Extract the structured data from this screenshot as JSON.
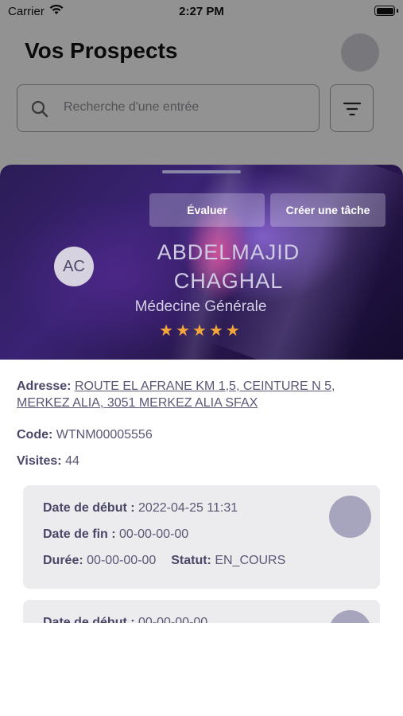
{
  "status_bar": {
    "carrier": "Carrier",
    "time": "2:27 PM"
  },
  "page": {
    "title": "Vos Prospects",
    "search_placeholder": "Recherche d'une entrée"
  },
  "sheet": {
    "buttons": {
      "evaluate": "Évaluer",
      "create_task": "Créer une tâche"
    },
    "avatar_initials": "AC",
    "name_line1": "ABDELMAJID",
    "name_line2": "CHAGHAL",
    "specialty": "Médecine Générale",
    "rating": 5,
    "stars": "★★★★★",
    "address_label": "Adresse:",
    "address_value": "ROUTE EL AFRANE KM 1,5, CEINTURE N 5, MERKEZ ALIA, 3051 MERKEZ ALIA SFAX",
    "code_label": "Code:",
    "code_value": "WTNM00005556",
    "visits_label": "Visites:",
    "visits_value": "44"
  },
  "visits": [
    {
      "start_label": "Date de début :",
      "start_value": "2022-04-25 11:31",
      "end_label": "Date de fin :",
      "end_value": "00-00-00-00",
      "duration_label": "Durée:",
      "duration_value": "00-00-00-00",
      "status_label": "Statut:",
      "status_value": "EN_COURS"
    },
    {
      "start_label": "Date de début :",
      "start_value": "00-00-00-00"
    }
  ],
  "colors": {
    "accent_text": "#5b5775",
    "star": "#f5a63a",
    "hero_dark": "#2b1c55",
    "card_bg": "#ececee"
  }
}
